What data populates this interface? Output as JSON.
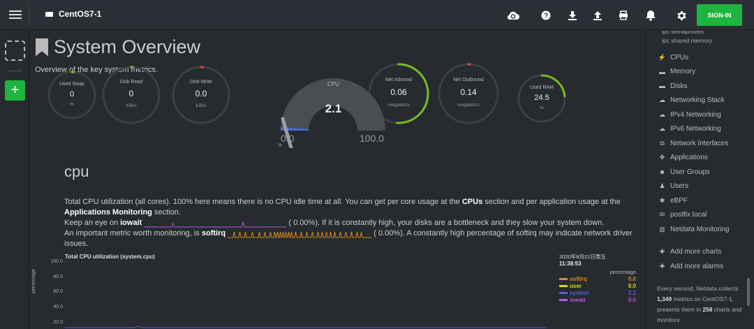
{
  "header": {
    "host": "CentOS7-1",
    "signin_label": "SIGN-IN",
    "icons": [
      "menu-icon",
      "server-icon",
      "cloud-sync-icon",
      "help-icon",
      "download-icon",
      "upload-icon",
      "print-icon",
      "bell-icon",
      "gear-icon"
    ]
  },
  "leftbar": {
    "add_label": "+"
  },
  "page": {
    "title": "System Overview",
    "subtitle": "Overview of the key system metrics."
  },
  "gauges": [
    {
      "label": "Used Swap",
      "value": "0",
      "unit": "%",
      "level": 0.0,
      "accent": "#77bb22"
    },
    {
      "label": "Disk Read",
      "value": "0",
      "unit": "KiB/s",
      "level": 0.0,
      "accent": "#77bb22"
    },
    {
      "label": "Disk Write",
      "value": "0.0",
      "unit": "KiB/s",
      "level": 0.0,
      "accent": "#e04830"
    },
    {
      "label": "Net Inbound",
      "value": "0.06",
      "unit": "megabits/s",
      "level": 0.52,
      "accent": "#77bb22"
    },
    {
      "label": "Net Outbound",
      "value": "0.14",
      "unit": "megabits/s",
      "level": 0.0,
      "accent": "#e04830"
    },
    {
      "label": "Used RAM",
      "value": "24.5",
      "unit": "%",
      "level": 0.245,
      "accent": "#77bb22"
    }
  ],
  "cpu_gauge": {
    "label": "CPU",
    "value": "2.1",
    "min": "0.0",
    "max": "100.0",
    "unit": "%",
    "level": 0.021
  },
  "section": {
    "heading": "cpu",
    "p1_a": "Total CPU utilization (all cores). 100% here means there is no CPU idle time at all. You can get per core usage at the ",
    "p1_b": "CPUs",
    "p1_c": " section and per application usage at the ",
    "p1_d": "Applications Monitoring",
    "p1_e": " section.",
    "p2_a": "Keep an eye on ",
    "p2_b": "iowait",
    "p2_c": " (       0.00%). If it is constantly high, your disks are a bottleneck and they slow your system down.",
    "p3_a": "An important metric worth monitoring, is ",
    "p3_b": "softirq",
    "p3_c": " (       0.00%). A constantly high percentage of softirq may indicate network driver issues."
  },
  "chart": {
    "title": "Total CPU utilization (system.cpu)",
    "ylabel": "percentage",
    "yticks": [
      "100.0",
      "80.0",
      "60.0",
      "40.0",
      "20.0"
    ],
    "date": "2020年8月21日周五",
    "time": "11:38:53",
    "unit_label": "percentage",
    "legend": [
      {
        "name": "softirq",
        "value": "0.0",
        "color": "#d98a1a"
      },
      {
        "name": "user",
        "value": "0.0",
        "color": "#d9d91a"
      },
      {
        "name": "system",
        "value": "2.1",
        "color": "#5560d9"
      },
      {
        "name": "iowait",
        "value": "0.0",
        "color": "#b55ad9"
      }
    ]
  },
  "chart_data": {
    "type": "area",
    "title": "Total CPU utilization (system.cpu)",
    "ylabel": "percentage",
    "ylim": [
      0,
      100
    ],
    "series": [
      {
        "name": "softirq",
        "values": [
          0.0
        ]
      },
      {
        "name": "user",
        "values": [
          0.0
        ]
      },
      {
        "name": "system",
        "values": [
          2.1
        ]
      },
      {
        "name": "iowait",
        "values": [
          0.0
        ]
      }
    ]
  },
  "sidebar": {
    "top_subitems": [
      "ipc semaphores",
      "ipc shared memory"
    ],
    "items": [
      {
        "label": "CPUs",
        "icon": "bolt-icon"
      },
      {
        "label": "Memory",
        "icon": "memory-icon"
      },
      {
        "label": "Disks",
        "icon": "disk-icon"
      },
      {
        "label": "Networking Stack",
        "icon": "cloud-icon"
      },
      {
        "label": "IPv4 Networking",
        "icon": "cloud-icon"
      },
      {
        "label": "IPv6 Networking",
        "icon": "cloud-icon"
      },
      {
        "label": "Network Interfaces",
        "icon": "network-icon"
      },
      {
        "label": "Applications",
        "icon": "applications-icon"
      },
      {
        "label": "User Groups",
        "icon": "users-icon"
      },
      {
        "label": "Users",
        "icon": "user-icon"
      },
      {
        "label": "eBPF",
        "icon": "puzzle-icon"
      },
      {
        "label": "postfix local",
        "icon": "envelope-icon"
      },
      {
        "label": "Netdata Monitoring",
        "icon": "bar-chart-icon"
      }
    ],
    "add_charts": "Add more charts",
    "add_alarms": "Add more alarms",
    "footer_a": "Every second, Netdata collects ",
    "footer_b": "1,349",
    "footer_c": " metrics on CentOS7-1, presents them in ",
    "footer_d": "258",
    "footer_e": " charts and monitors"
  }
}
